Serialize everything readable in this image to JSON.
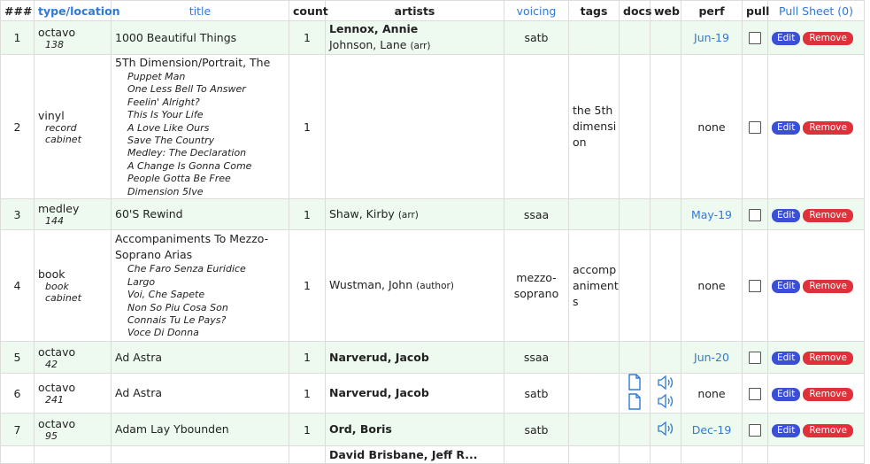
{
  "headers": {
    "num": "###",
    "type_location": "type/location",
    "title": "title",
    "count": "count",
    "artists": "artists",
    "voicing": "voicing",
    "tags": "tags",
    "docs": "docs",
    "web": "web",
    "perf": "perf",
    "pull": "pull",
    "pull_sheet": "Pull Sheet (0)"
  },
  "buttons": {
    "edit": "Edit",
    "remove": "Remove"
  },
  "icons": {
    "doc": "document-icon",
    "audio": "speaker-icon"
  },
  "colors": {
    "link": "#2f7ad6",
    "edit": "#3a4fd6",
    "remove": "#e0303a",
    "row_highlight": "#eefaf0"
  },
  "rows": [
    {
      "num": "1",
      "type": "octavo",
      "location": "138",
      "title": "1000 Beautiful Things",
      "songs": [],
      "count": "1",
      "artists": [
        {
          "name": "Lennox, Annie",
          "role": "",
          "bold": true
        },
        {
          "name": "Johnson, Lane",
          "role": "(arr)",
          "bold": false
        }
      ],
      "voicing": "satb",
      "tags": [],
      "docs": 0,
      "web": 0,
      "perf": "Jun-19",
      "perf_link": true
    },
    {
      "num": "2",
      "type": "vinyl",
      "location": "record cabinet",
      "title": "5Th Dimension/Portrait, The",
      "songs": [
        "Puppet Man",
        "One Less Bell To Answer",
        "Feelin' Alright?",
        "This Is Your Life",
        "A Love Like Ours",
        "Save The Country",
        "Medley: The Declaration",
        "A Change Is Gonna Come",
        "People Gotta Be Free",
        "Dimension 5Ive"
      ],
      "count": "1",
      "artists": [],
      "voicing": "",
      "tags": [
        "the 5th",
        "dimensi",
        "on"
      ],
      "docs": 0,
      "web": 0,
      "perf": "none",
      "perf_link": false
    },
    {
      "num": "3",
      "type": "medley",
      "location": "144",
      "title": "60'S Rewind",
      "songs": [],
      "count": "1",
      "artists": [
        {
          "name": "Shaw, Kirby",
          "role": "(arr)",
          "bold": false
        }
      ],
      "voicing": "ssaa",
      "tags": [],
      "docs": 0,
      "web": 0,
      "perf": "May-19",
      "perf_link": true
    },
    {
      "num": "4",
      "type": "book",
      "location": "book cabinet",
      "title": "Accompaniments To Mezzo-Soprano Arias",
      "songs": [
        "Che Faro Senza Euridice",
        "Largo",
        "Voi, Che Sapete",
        "Non So Piu Cosa Son",
        "Connais Tu Le Pays?",
        "Voce Di Donna"
      ],
      "count": "1",
      "artists": [
        {
          "name": "Wustman, John",
          "role": "(author)",
          "bold": false
        }
      ],
      "voicing": "mezzo-soprano",
      "tags": [
        "accomp",
        "animent",
        "s"
      ],
      "docs": 0,
      "web": 0,
      "perf": "none",
      "perf_link": false
    },
    {
      "num": "5",
      "type": "octavo",
      "location": "42",
      "title": "Ad Astra",
      "songs": [],
      "count": "1",
      "artists": [
        {
          "name": "Narverud, Jacob",
          "role": "",
          "bold": true
        }
      ],
      "voicing": "ssaa",
      "tags": [],
      "docs": 0,
      "web": 0,
      "perf": "Jun-20",
      "perf_link": true
    },
    {
      "num": "6",
      "type": "octavo",
      "location": "241",
      "title": "Ad Astra",
      "songs": [],
      "count": "1",
      "artists": [
        {
          "name": "Narverud, Jacob",
          "role": "",
          "bold": true
        }
      ],
      "voicing": "satb",
      "tags": [],
      "docs": 2,
      "web": 2,
      "perf": "none",
      "perf_link": false
    },
    {
      "num": "7",
      "type": "octavo",
      "location": "95",
      "title": "Adam Lay Ybounden",
      "songs": [],
      "count": "1",
      "artists": [
        {
          "name": "Ord, Boris",
          "role": "",
          "bold": true
        }
      ],
      "voicing": "satb",
      "tags": [],
      "docs": 0,
      "web": 1,
      "perf": "Dec-19",
      "perf_link": true
    },
    {
      "num": "",
      "type": "",
      "location": "",
      "title": "",
      "songs": [],
      "count": "",
      "artists": [
        {
          "name": "David Brisbane, Jeff R...",
          "role": "",
          "bold": true
        }
      ],
      "voicing": "",
      "tags": [],
      "docs": 0,
      "web": 0,
      "perf": "",
      "perf_link": false
    }
  ]
}
